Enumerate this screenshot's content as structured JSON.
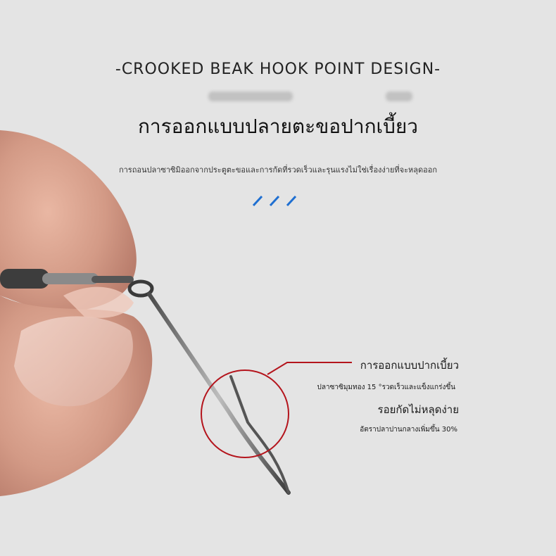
{
  "title": "-CROOKED BEAK HOOK POINT DESIGN-",
  "headline": "การออกแบบปลายตะขอปากเบี้ยว",
  "subline": "การถอนปลาซาซิมิออกจากประตูตะขอและการกัดที่รวดเร็วและรุนแรงไม่ใช่เรื่องง่ายที่จะหลุดออก",
  "callout": {
    "label1": "การออกแบบปากเบี้ยว",
    "label2": "ปลาซาซิมุมทอง 15 °รวดเร็วและแข็งแกร่งขึ้น",
    "label3": "รอยกัดไม่หลุดง่าย",
    "label4": "อัตราปลาปานกลางเพิ่มขึ้น 30%"
  },
  "colors": {
    "background": "#e4e4e4",
    "accent_blue": "#1f6fd1",
    "callout_red": "#b4141c"
  }
}
